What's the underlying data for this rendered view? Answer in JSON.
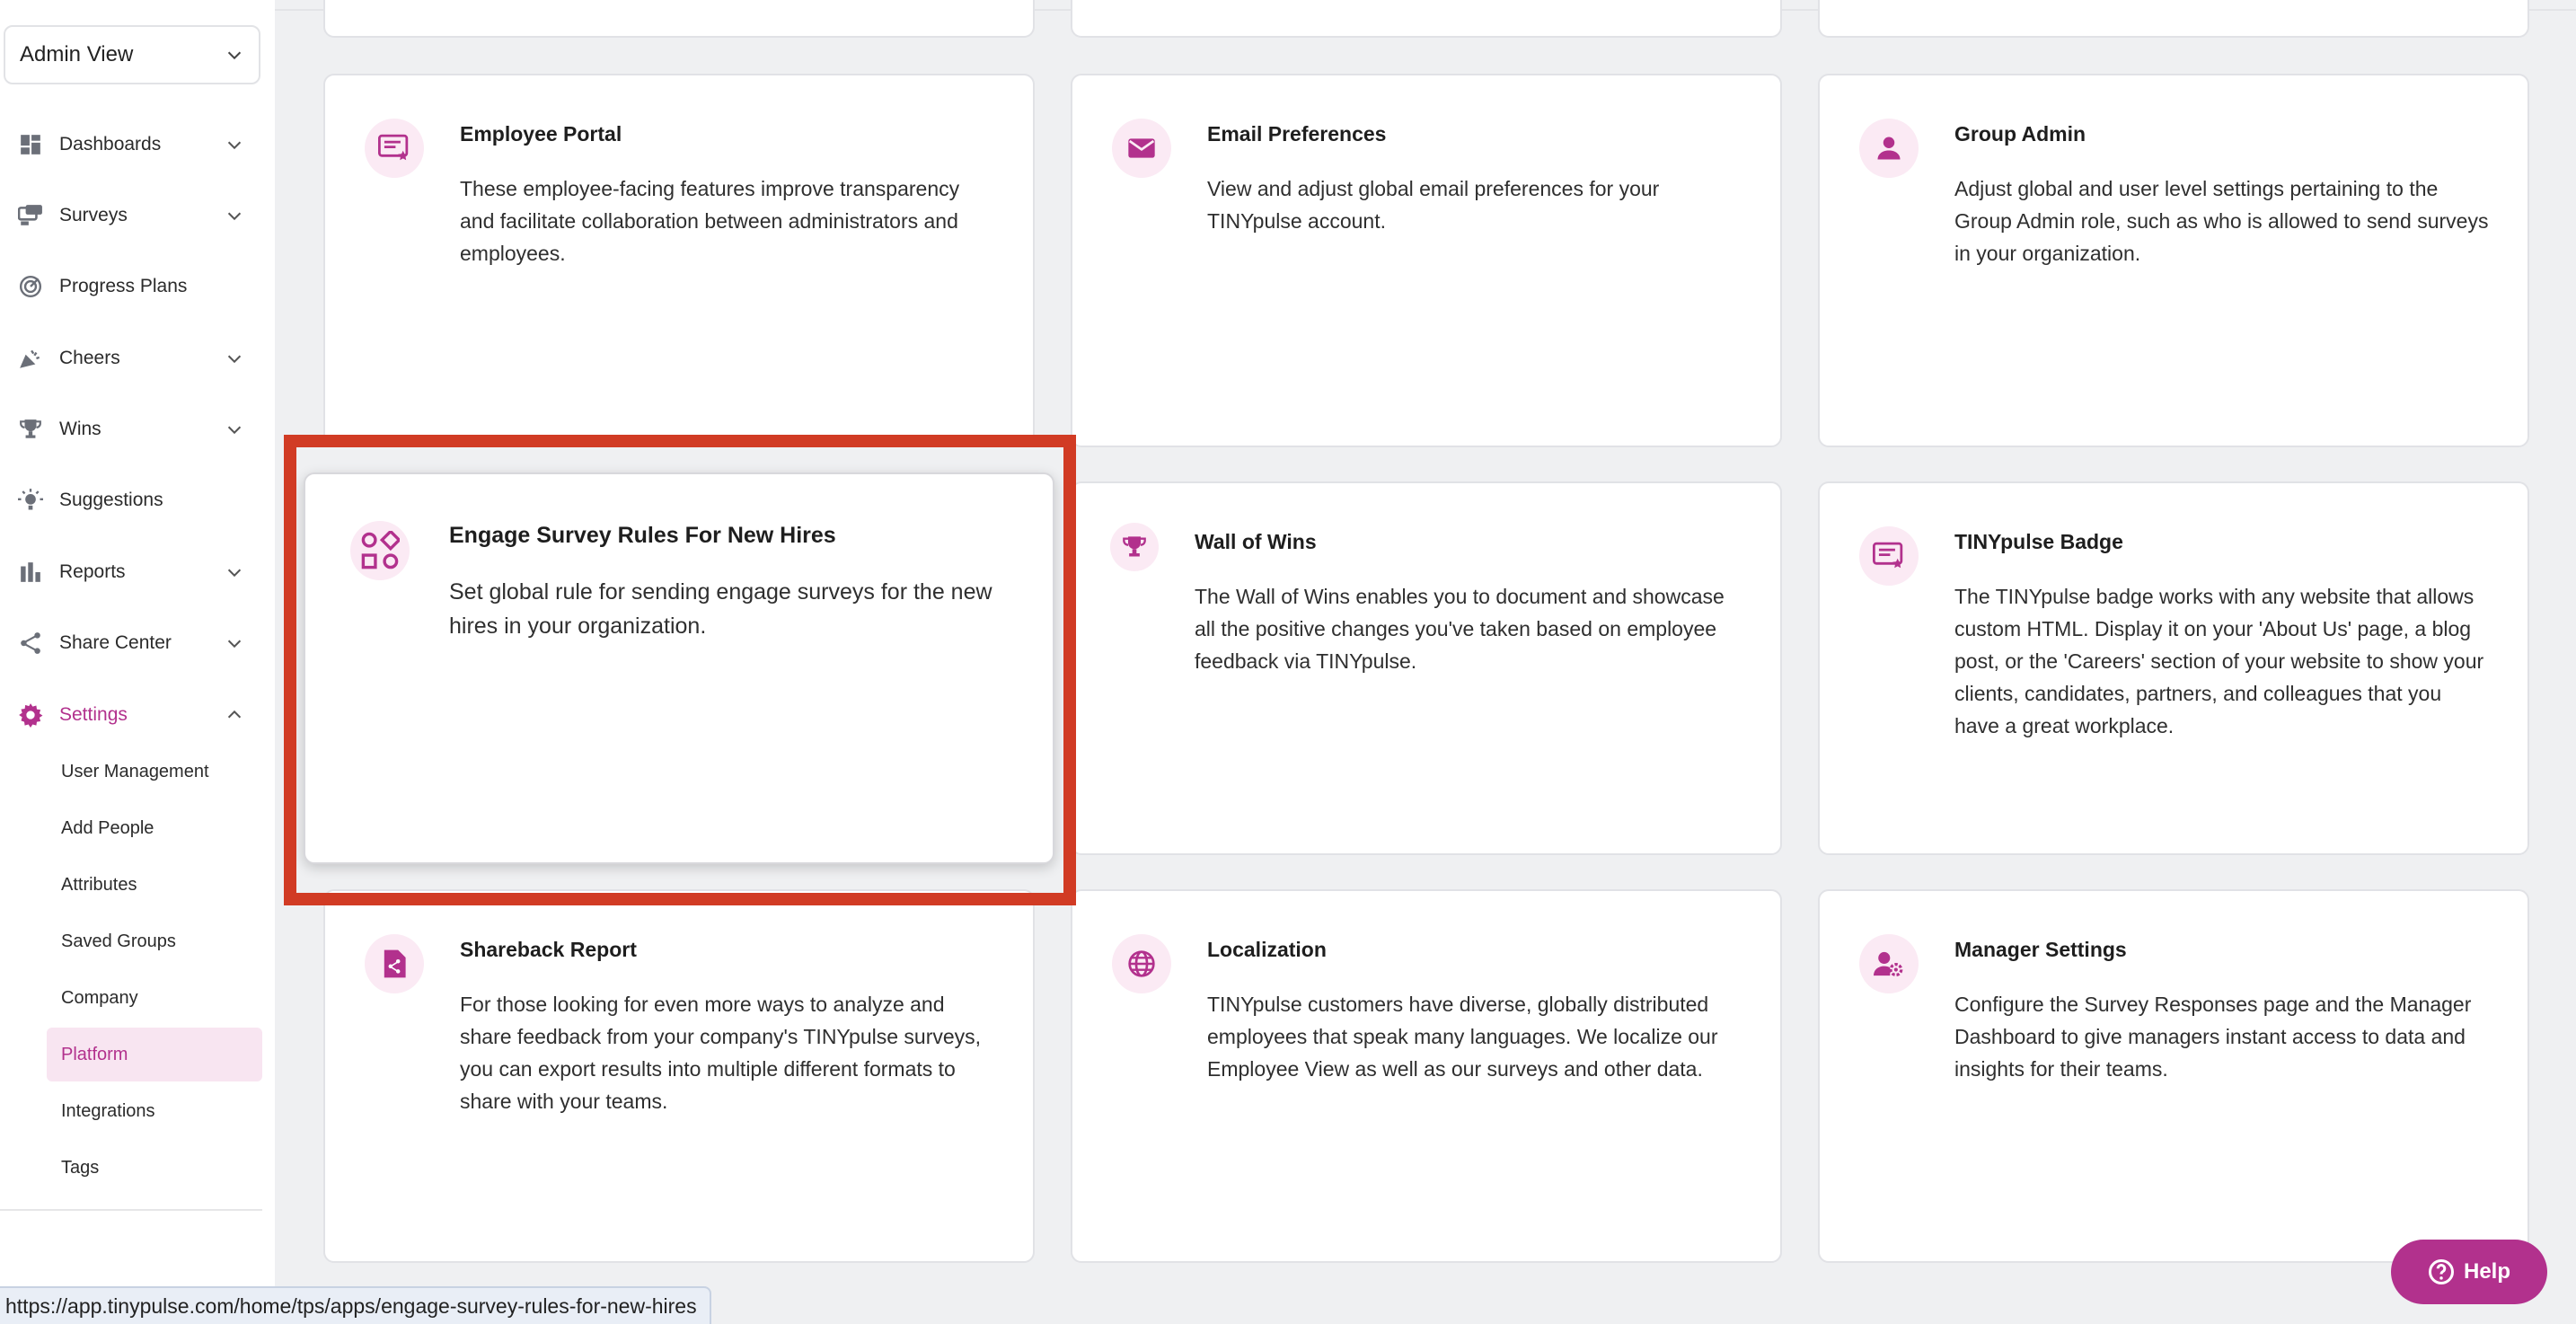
{
  "sidebar": {
    "view_select": "Admin View",
    "nav": [
      {
        "label": "Dashboards",
        "icon": "dashboard-icon",
        "has_chevron": true
      },
      {
        "label": "Surveys",
        "icon": "surveys-icon",
        "has_chevron": true
      },
      {
        "label": "Progress Plans",
        "icon": "progress-plans-icon",
        "has_chevron": false
      },
      {
        "label": "Cheers",
        "icon": "cheers-icon",
        "has_chevron": true
      },
      {
        "label": "Wins",
        "icon": "trophy-icon",
        "has_chevron": true
      },
      {
        "label": "Suggestions",
        "icon": "lightbulb-icon",
        "has_chevron": false
      },
      {
        "label": "Reports",
        "icon": "reports-icon",
        "has_chevron": true
      },
      {
        "label": "Share Center",
        "icon": "share-icon",
        "has_chevron": true
      },
      {
        "label": "Settings",
        "icon": "gear-icon",
        "has_chevron": true,
        "expanded": true
      }
    ],
    "settings_items": [
      "User Management",
      "Add People",
      "Attributes",
      "Saved Groups",
      "Company",
      "Platform",
      "Integrations",
      "Tags"
    ],
    "active_settings_item": "Platform"
  },
  "cards": [
    {
      "title": "Employee Portal",
      "icon": "portal-badge-icon",
      "description": "These employee-facing features improve transparency and facilitate collaboration between administrators and employees."
    },
    {
      "title": "Email Preferences",
      "icon": "envelope-icon",
      "description": "View and adjust global email preferences for your TINYpulse account."
    },
    {
      "title": "Group Admin",
      "icon": "person-icon",
      "description": "Adjust global and user level settings pertaining to the Group Admin role, such as who is allowed to send surveys in your organization."
    },
    {
      "title": "Engage Survey Rules For New Hires",
      "icon": "shapes-icon",
      "description": "Set global rule for sending engage surveys for the new hires in your organization."
    },
    {
      "title": "Wall of Wins",
      "icon": "trophy-icon",
      "description": "The Wall of Wins enables you to document and showcase all the positive changes you've taken based on employee feedback via TINYpulse."
    },
    {
      "title": "TINYpulse Badge",
      "icon": "badge-icon",
      "description": "The TINYpulse badge works with any website that allows custom HTML. Display it on your 'About Us' page, a blog post, or the 'Careers' section of your website to show your clients, candidates, partners, and colleagues that you have a great workplace."
    },
    {
      "title": "Shareback Report",
      "icon": "shareback-file-icon",
      "description": "For those looking for even more ways to analyze and share feedback from your company's TINYpulse surveys, you can export results into multiple different formats to share with your teams."
    },
    {
      "title": "Localization",
      "icon": "globe-icon",
      "description": "TINYpulse customers have diverse, globally distributed employees that speak many languages. We localize our Employee View as well as our surveys and other data."
    },
    {
      "title": "Manager Settings",
      "icon": "manager-gear-icon",
      "description": "Configure the Survey Responses page and the Manager Dashboard to give managers instant access to data and insights for their teams."
    }
  ],
  "help_label": "Help",
  "status_url": "https://app.tinypulse.com/home/tps/apps/engage-survey-rules-for-new-hires",
  "colors": {
    "accent": "#b2318d",
    "highlight": "#d13b24",
    "icon_bg": "#fbeaf4"
  }
}
